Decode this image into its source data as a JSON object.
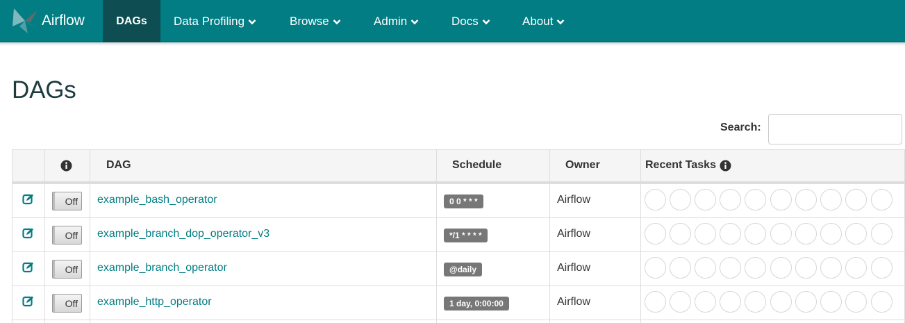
{
  "navbar": {
    "brand": "Airflow",
    "items": [
      {
        "label": "DAGs"
      },
      {
        "label": "Data Profiling"
      },
      {
        "label": "Browse"
      },
      {
        "label": "Admin"
      },
      {
        "label": "Docs"
      },
      {
        "label": "About"
      }
    ],
    "color": "#017d83",
    "active_color": "#0e4d52"
  },
  "page": {
    "title": "DAGs",
    "search_label": "Search:",
    "search_value": ""
  },
  "table": {
    "headers": {
      "info_icon": "info-circle-icon",
      "dag": "DAG",
      "schedule": "Schedule",
      "owner": "Owner",
      "recent_tasks": "Recent Tasks"
    },
    "rows": [
      {
        "toggle": "Off",
        "dag_id": "example_bash_operator",
        "schedule": "0 0 * * *",
        "owner": "Airflow"
      },
      {
        "toggle": "Off",
        "dag_id": "example_branch_dop_operator_v3",
        "schedule": "*/1 * * * *",
        "owner": "Airflow"
      },
      {
        "toggle": "Off",
        "dag_id": "example_branch_operator",
        "schedule": "@daily",
        "owner": "Airflow"
      },
      {
        "toggle": "Off",
        "dag_id": "example_http_operator",
        "schedule": "1 day, 0:00:00",
        "owner": "Airflow"
      }
    ],
    "recent_task_slots": 10
  }
}
